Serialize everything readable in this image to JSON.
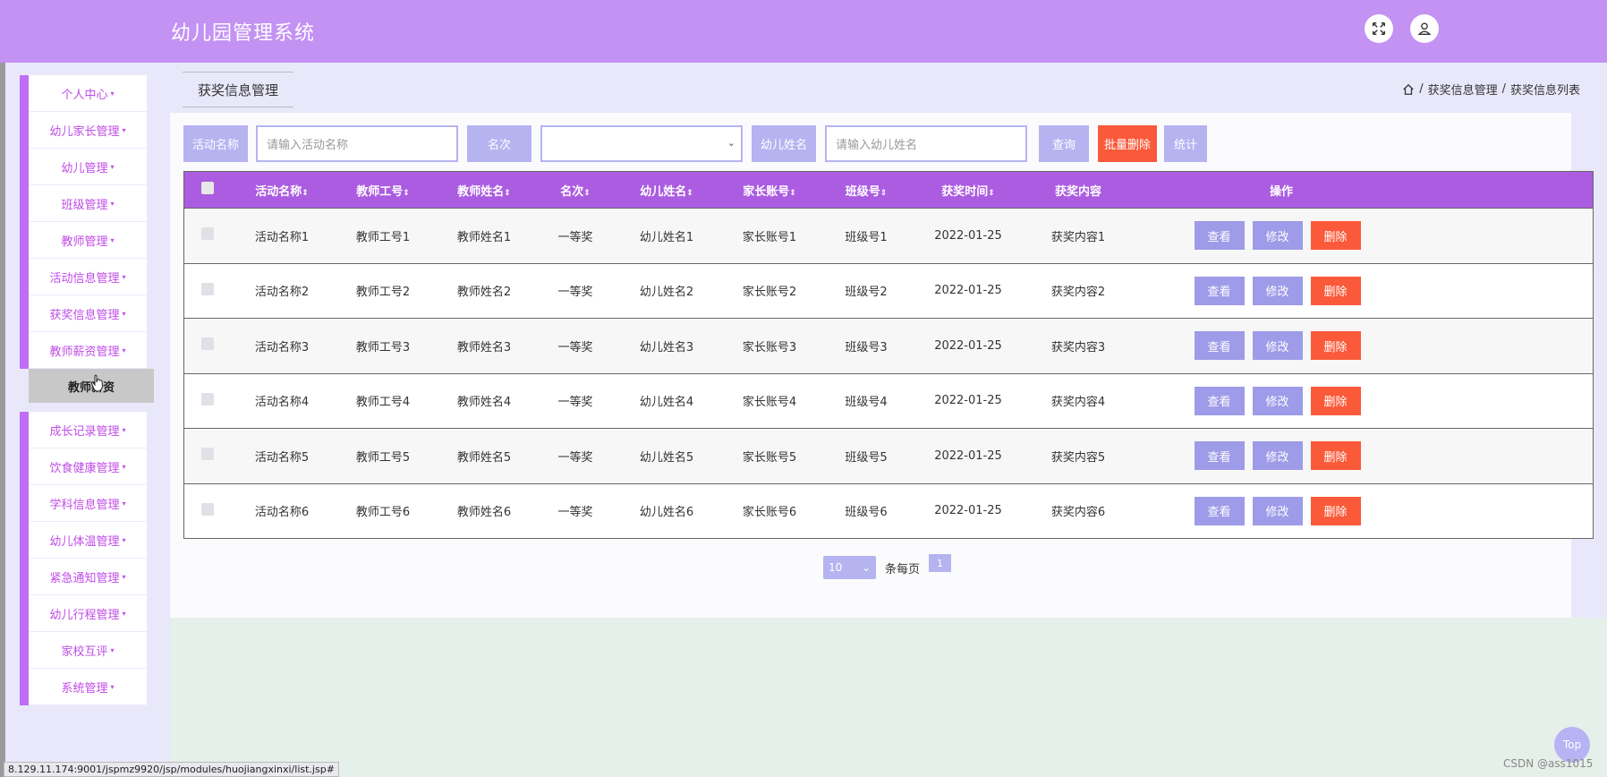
{
  "header": {
    "title": "幼儿园管理系统"
  },
  "sidebar": {
    "items_top": [
      "个人中心",
      "幼儿家长管理",
      "幼儿管理",
      "班级管理",
      "教师管理",
      "活动信息管理",
      "获奖信息管理",
      "教师薪资管理"
    ],
    "submenu_item": "教师薪资",
    "items_bottom": [
      "成长记录管理",
      "饮食健康管理",
      "学科信息管理",
      "幼儿体温管理",
      "紧急通知管理",
      "幼儿行程管理",
      "家校互评",
      "系统管理"
    ]
  },
  "tab": {
    "label": "获奖信息管理"
  },
  "breadcrumb": {
    "section": "获奖信息管理",
    "page": "获奖信息列表",
    "separator": "/"
  },
  "search": {
    "activity_label": "活动名称",
    "activity_placeholder": "请输入活动名称",
    "rank_label": "名次",
    "rank_value": "",
    "child_label": "幼儿姓名",
    "child_placeholder": "请输入幼儿姓名",
    "query_button": "查询",
    "batch_delete_button": "批量删除",
    "stats_button": "统计"
  },
  "table": {
    "columns": [
      "活动名称",
      "教师工号",
      "教师姓名",
      "名次",
      "幼儿姓名",
      "家长账号",
      "班级号",
      "获奖时间",
      "获奖内容",
      "操作"
    ],
    "sort_icon": "⇕",
    "rows": [
      [
        "活动名称1",
        "教师工号1",
        "教师姓名1",
        "一等奖",
        "幼儿姓名1",
        "家长账号1",
        "班级号1",
        "2022-01-25",
        "获奖内容1"
      ],
      [
        "活动名称2",
        "教师工号2",
        "教师姓名2",
        "一等奖",
        "幼儿姓名2",
        "家长账号2",
        "班级号2",
        "2022-01-25",
        "获奖内容2"
      ],
      [
        "活动名称3",
        "教师工号3",
        "教师姓名3",
        "一等奖",
        "幼儿姓名3",
        "家长账号3",
        "班级号3",
        "2022-01-25",
        "获奖内容3"
      ],
      [
        "活动名称4",
        "教师工号4",
        "教师姓名4",
        "一等奖",
        "幼儿姓名4",
        "家长账号4",
        "班级号4",
        "2022-01-25",
        "获奖内容4"
      ],
      [
        "活动名称5",
        "教师工号5",
        "教师姓名5",
        "一等奖",
        "幼儿姓名5",
        "家长账号5",
        "班级号5",
        "2022-01-25",
        "获奖内容5"
      ],
      [
        "活动名称6",
        "教师工号6",
        "教师姓名6",
        "一等奖",
        "幼儿姓名6",
        "家长账号6",
        "班级号6",
        "2022-01-25",
        "获奖内容6"
      ]
    ],
    "actions": {
      "view": "查看",
      "edit": "修改",
      "delete": "删除"
    }
  },
  "pagination": {
    "page_size": "10",
    "per_page_label": "条每页",
    "current_page": "1"
  },
  "top_button": "Top",
  "status_url": "8.129.11.174:9001/jspmz9920/jsp/modules/huojiangxinxi/list.jsp#",
  "watermark": "CSDN @ass1015",
  "colors": {
    "header": "#c392f3",
    "accent": "#ab5ce0",
    "primary_button": "#b6b3f1",
    "danger": "#fb5a3a"
  }
}
